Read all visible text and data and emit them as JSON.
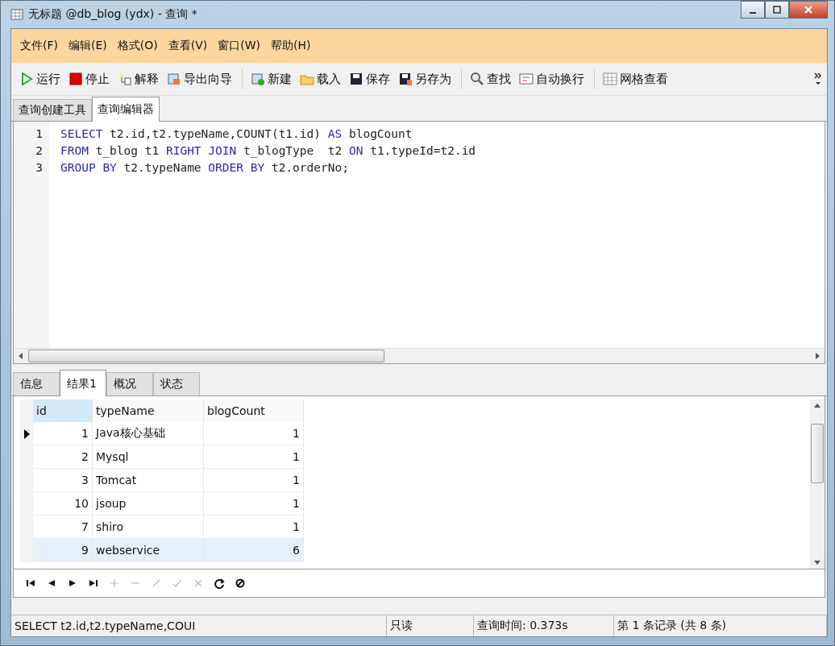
{
  "window": {
    "title": "无标题 @db_blog (ydx) - 查询 *"
  },
  "menu": [
    "文件(F)",
    "编辑(E)",
    "格式(O)",
    "查看(V)",
    "窗口(W)",
    "帮助(H)"
  ],
  "toolbar": [
    {
      "kind": "run",
      "label": "运行",
      "group_start": false
    },
    {
      "kind": "stop",
      "label": "停止",
      "group_start": false
    },
    {
      "kind": "explain",
      "label": "解释",
      "group_start": false
    },
    {
      "kind": "export",
      "label": "导出向导",
      "group_start": false
    },
    {
      "kind": "new",
      "label": "新建",
      "group_start": true
    },
    {
      "kind": "load",
      "label": "载入",
      "group_start": false
    },
    {
      "kind": "save",
      "label": "保存",
      "group_start": false
    },
    {
      "kind": "saveas",
      "label": "另存为",
      "group_start": false
    },
    {
      "kind": "find",
      "label": "查找",
      "group_start": true
    },
    {
      "kind": "wrap",
      "label": "自动换行",
      "group_start": false
    },
    {
      "kind": "grid",
      "label": "网格查看",
      "group_start": true
    }
  ],
  "editor_tabs": [
    {
      "label": "查询创建工具",
      "selected": false
    },
    {
      "label": "查询编辑器",
      "selected": true
    }
  ],
  "sql_lines": [
    {
      "number": "1",
      "tokens": [
        {
          "text": "SELECT",
          "kind": "keyword"
        },
        {
          "text": " t2.id,t2.typeName,COUNT(t1.id) ",
          "kind": "plain"
        },
        {
          "text": "AS",
          "kind": "keyword"
        },
        {
          "text": " blogCount",
          "kind": "plain"
        }
      ]
    },
    {
      "number": "2",
      "tokens": [
        {
          "text": "FROM",
          "kind": "keyword"
        },
        {
          "text": " t_blog t1 ",
          "kind": "plain"
        },
        {
          "text": "RIGHT JOIN",
          "kind": "keyword"
        },
        {
          "text": " t_blogType  t2 ",
          "kind": "plain"
        },
        {
          "text": "ON",
          "kind": "keyword"
        },
        {
          "text": " t1.typeId=t2.id",
          "kind": "plain"
        }
      ]
    },
    {
      "number": "3",
      "tokens": [
        {
          "text": "GROUP BY",
          "kind": "keyword"
        },
        {
          "text": " t2.typeName ",
          "kind": "plain"
        },
        {
          "text": "ORDER BY",
          "kind": "keyword"
        },
        {
          "text": " t2.orderNo;",
          "kind": "plain"
        }
      ]
    }
  ],
  "result_tabs": [
    {
      "label": "信息",
      "selected": false
    },
    {
      "label": "结果1",
      "selected": true
    },
    {
      "label": "概况",
      "selected": false
    },
    {
      "label": "状态",
      "selected": false
    }
  ],
  "table": {
    "columns": [
      "id",
      "typeName",
      "blogCount"
    ],
    "rows": [
      {
        "cells": [
          "1",
          "Java核心基础",
          "1"
        ],
        "current": true,
        "selected": false
      },
      {
        "cells": [
          "2",
          "Mysql",
          "1"
        ],
        "current": false,
        "selected": false
      },
      {
        "cells": [
          "3",
          "Tomcat",
          "1"
        ],
        "current": false,
        "selected": false
      },
      {
        "cells": [
          "10",
          "jsoup",
          "1"
        ],
        "current": false,
        "selected": false
      },
      {
        "cells": [
          "7",
          "shiro",
          "1"
        ],
        "current": false,
        "selected": false
      },
      {
        "cells": [
          "9",
          "webservice",
          "6"
        ],
        "current": false,
        "selected": true
      }
    ]
  },
  "navigator": [
    {
      "kind": "first",
      "disabled": false
    },
    {
      "kind": "prev",
      "disabled": false
    },
    {
      "kind": "next",
      "disabled": false
    },
    {
      "kind": "last",
      "disabled": false
    },
    {
      "kind": "insert",
      "disabled": true
    },
    {
      "kind": "delete",
      "disabled": true
    },
    {
      "kind": "edit",
      "disabled": true
    },
    {
      "kind": "apply",
      "disabled": true
    },
    {
      "kind": "cancel",
      "disabled": true
    },
    {
      "kind": "refresh",
      "disabled": false
    },
    {
      "kind": "stop",
      "disabled": false
    }
  ],
  "status_bar": {
    "sql": "SELECT t2.id,t2.typeName,COUI",
    "mode": "只读",
    "time": "查询时间: 0.373s",
    "record": "第 1 条记录 (共 8 条)"
  }
}
